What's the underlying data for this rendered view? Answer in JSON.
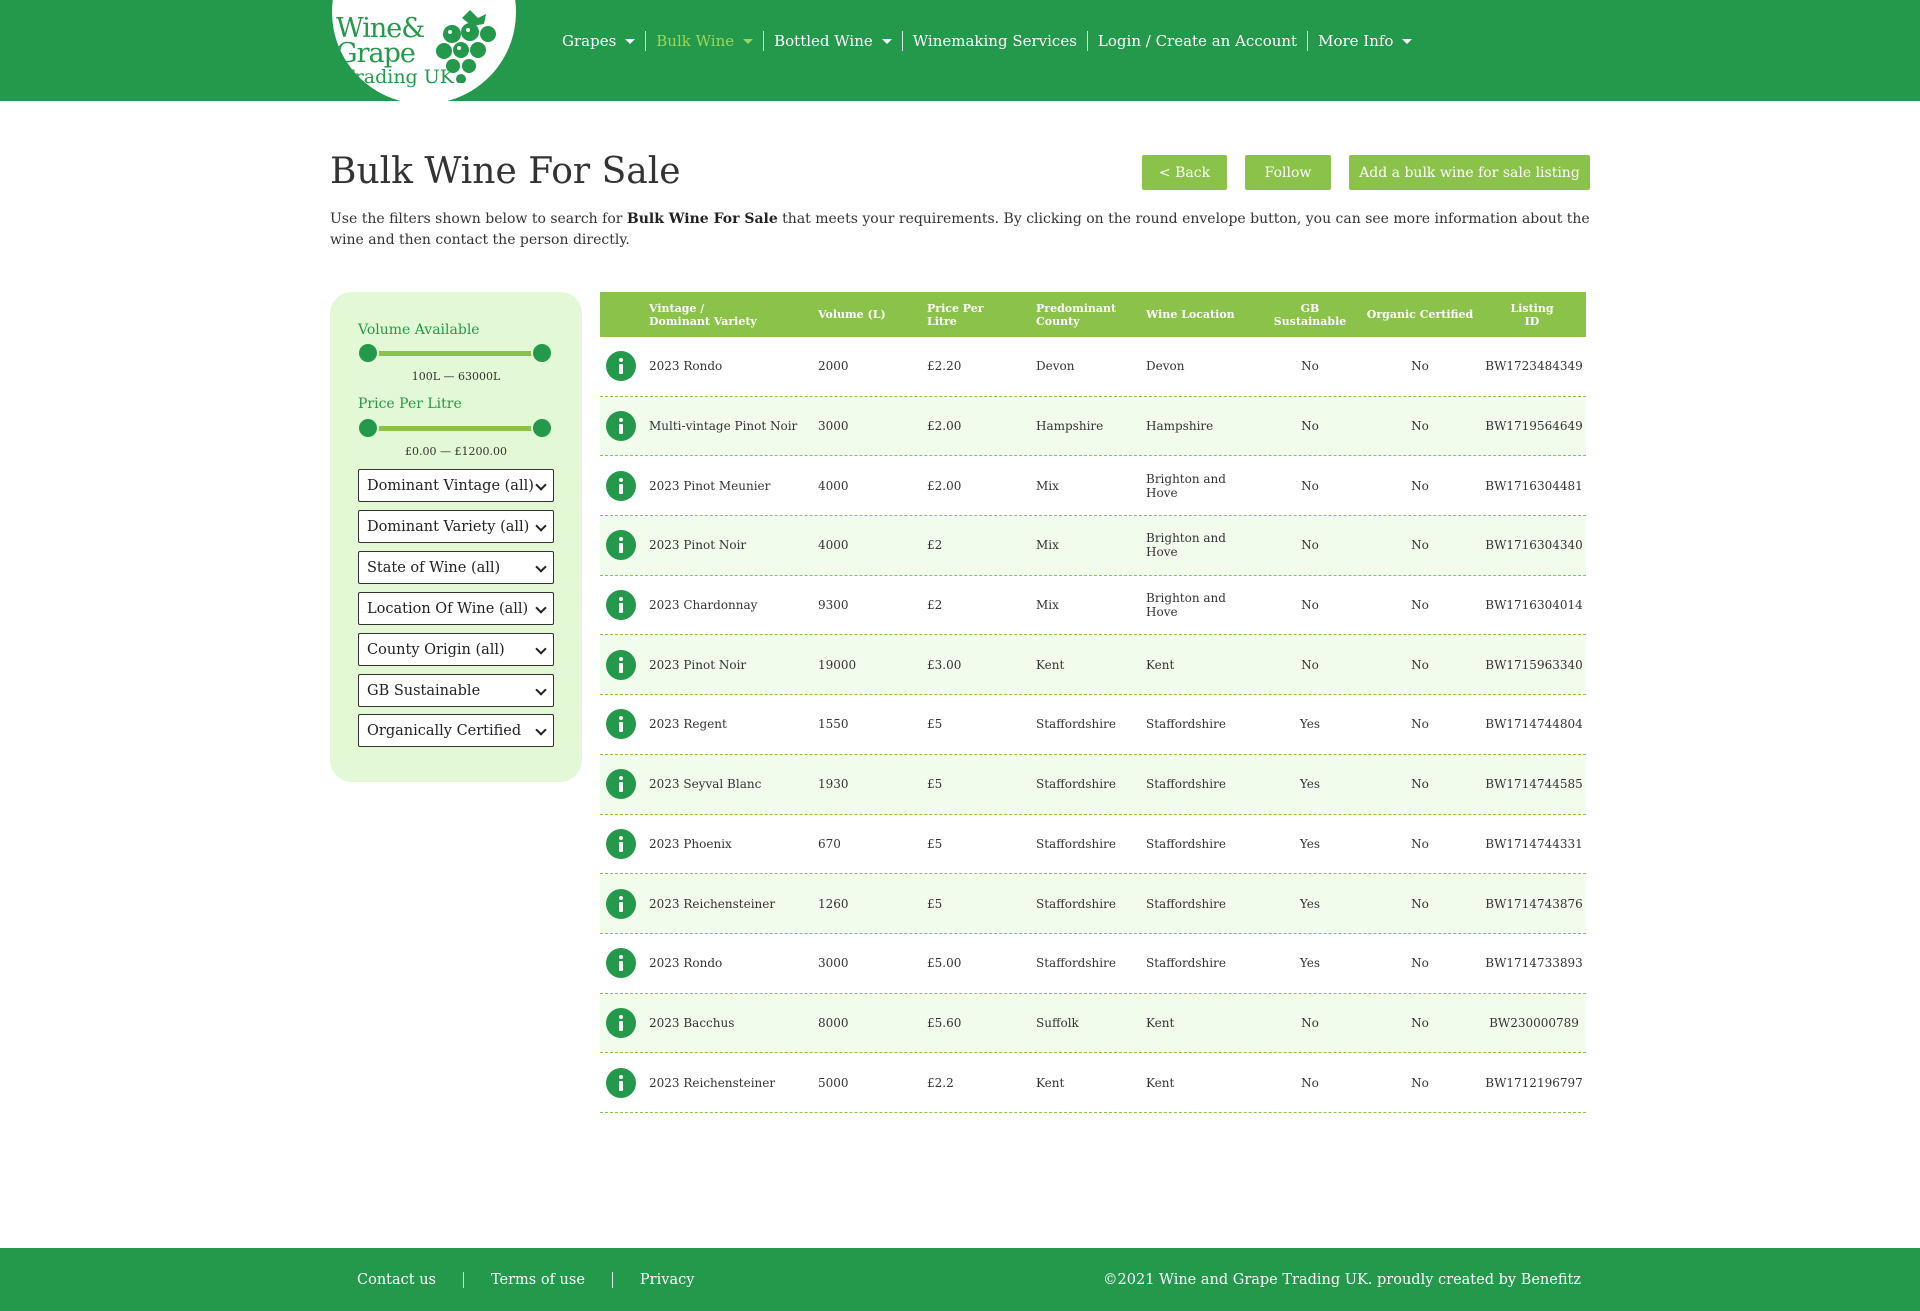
{
  "logo": {
    "line1": "Wine&",
    "line2": "Grape",
    "line3": "Trading UK"
  },
  "nav": {
    "items": [
      {
        "label": "Grapes",
        "has_caret": true,
        "active": false
      },
      {
        "label": "Bulk Wine",
        "has_caret": true,
        "active": true
      },
      {
        "label": "Bottled Wine",
        "has_caret": true,
        "active": false
      },
      {
        "label": "Winemaking Services",
        "has_caret": false,
        "active": false
      },
      {
        "label": "Login / Create an Account",
        "has_caret": false,
        "active": false
      },
      {
        "label": "More Info",
        "has_caret": true,
        "active": false
      }
    ]
  },
  "page": {
    "title": "Bulk Wine For Sale",
    "back_label": "< Back",
    "follow_label": "Follow",
    "add_listing_label": "Add a bulk wine for sale listing",
    "intro_before": "Use the filters shown below to search for ",
    "intro_bold": "Bulk Wine For Sale",
    "intro_after": " that meets your requirements. By clicking on the round envelope button, you can see more information about the wine and then contact the person directly."
  },
  "filters": {
    "volume_label": "Volume Available",
    "volume_range": "100L — 63000L",
    "price_label": "Price Per Litre",
    "price_range": "£0.00 — £1200.00",
    "selects": [
      "Dominant Vintage (all)",
      "Dominant Variety (all)",
      "State of Wine (all)",
      "Location Of Wine (all)",
      "County Origin (all)",
      "GB Sustainable",
      "Organically Certified"
    ]
  },
  "table": {
    "headers": {
      "vintage_line1": "Vintage /",
      "vintage_line2": "Dominant Variety",
      "volume": "Volume (L)",
      "price_line1": "Price Per",
      "price_line2": "Litre",
      "county_line1": "Predominant",
      "county_line2": "County",
      "location": "Wine Location",
      "gb_line1": "GB",
      "gb_line2": "Sustainable",
      "organic": "Organic Certified",
      "listing_line1": "Listing",
      "listing_line2": "ID"
    },
    "rows": [
      {
        "variety": "2023 Rondo",
        "volume": "2000",
        "price": "£2.20",
        "county": "Devon",
        "location": "Devon",
        "gb": "No",
        "organic": "No",
        "id": "BW1723484349"
      },
      {
        "variety": "Multi-vintage Pinot Noir",
        "volume": "3000",
        "price": "£2.00",
        "county": "Hampshire",
        "location": "Hampshire",
        "gb": "No",
        "organic": "No",
        "id": "BW1719564649"
      },
      {
        "variety": "2023 Pinot Meunier",
        "volume": "4000",
        "price": "£2.00",
        "county": "Mix",
        "location": "Brighton and Hove",
        "gb": "No",
        "organic": "No",
        "id": "BW1716304481"
      },
      {
        "variety": "2023 Pinot Noir",
        "volume": "4000",
        "price": "£2",
        "county": "Mix",
        "location": "Brighton and Hove",
        "gb": "No",
        "organic": "No",
        "id": "BW1716304340"
      },
      {
        "variety": "2023 Chardonnay",
        "volume": "9300",
        "price": "£2",
        "county": "Mix",
        "location": "Brighton and Hove",
        "gb": "No",
        "organic": "No",
        "id": "BW1716304014"
      },
      {
        "variety": "2023 Pinot Noir",
        "volume": "19000",
        "price": "£3.00",
        "county": "Kent",
        "location": "Kent",
        "gb": "No",
        "organic": "No",
        "id": "BW1715963340"
      },
      {
        "variety": "2023 Regent",
        "volume": "1550",
        "price": "£5",
        "county": "Staffordshire",
        "location": "Staffordshire",
        "gb": "Yes",
        "organic": "No",
        "id": "BW1714744804"
      },
      {
        "variety": "2023 Seyval Blanc",
        "volume": "1930",
        "price": "£5",
        "county": "Staffordshire",
        "location": "Staffordshire",
        "gb": "Yes",
        "organic": "No",
        "id": "BW1714744585"
      },
      {
        "variety": "2023 Phoenix",
        "volume": "670",
        "price": "£5",
        "county": "Staffordshire",
        "location": "Staffordshire",
        "gb": "Yes",
        "organic": "No",
        "id": "BW1714744331"
      },
      {
        "variety": "2023 Reichensteiner",
        "volume": "1260",
        "price": "£5",
        "county": "Staffordshire",
        "location": "Staffordshire",
        "gb": "Yes",
        "organic": "No",
        "id": "BW1714743876"
      },
      {
        "variety": "2023 Rondo",
        "volume": "3000",
        "price": "£5.00",
        "county": "Staffordshire",
        "location": "Staffordshire",
        "gb": "Yes",
        "organic": "No",
        "id": "BW1714733893"
      },
      {
        "variety": "2023 Bacchus",
        "volume": "8000",
        "price": "£5.60",
        "county": "Suffolk",
        "location": "Kent",
        "gb": "No",
        "organic": "No",
        "id": "BW230000789"
      },
      {
        "variety": "2023 Reichensteiner",
        "volume": "5000",
        "price": "£2.2",
        "county": "Kent",
        "location": "Kent",
        "gb": "No",
        "organic": "No",
        "id": "BW1712196797"
      }
    ]
  },
  "footer": {
    "links": [
      "Contact us",
      "Terms of use",
      "Privacy"
    ],
    "copyright": "©2021 Wine and Grape Trading UK. proudly created by Benefitz"
  },
  "colors": {
    "primary_green": "#24994c",
    "accent_green": "#8bc34a",
    "sidebar_bg": "#e3f8d4",
    "row_alt_bg": "#f2fcec",
    "active_nav": "#9ad65a"
  }
}
